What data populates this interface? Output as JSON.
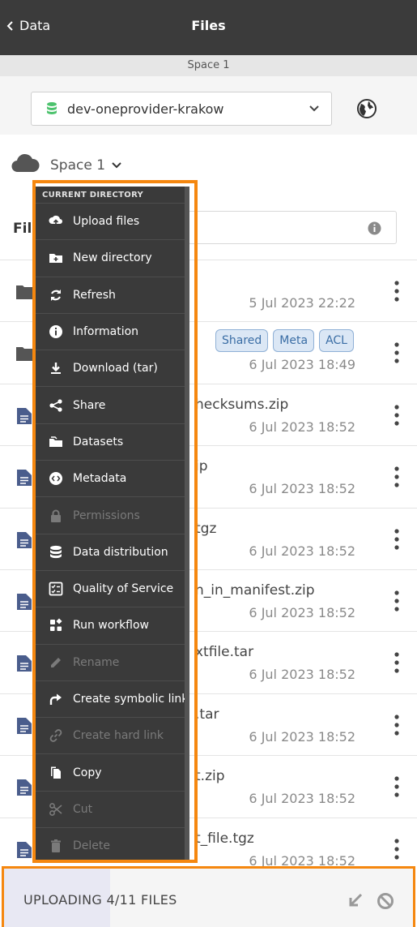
{
  "header": {
    "back_label": "Data",
    "title": "Files"
  },
  "space_bar": {
    "label": "Space 1"
  },
  "provider": {
    "selected": "dev-oneprovider-krakow"
  },
  "breadcrumb": {
    "label": "Space 1"
  },
  "files_heading": "File",
  "context_menu": {
    "header": "CURRENT DIRECTORY",
    "items": [
      {
        "label": "Upload files",
        "icon": "upload-icon",
        "disabled": false
      },
      {
        "label": "New directory",
        "icon": "new-folder-icon",
        "disabled": false
      },
      {
        "label": "Refresh",
        "icon": "refresh-icon",
        "disabled": false
      },
      {
        "label": "Information",
        "icon": "info-icon",
        "disabled": false
      },
      {
        "label": "Download (tar)",
        "icon": "download-icon",
        "disabled": false
      },
      {
        "label": "Share",
        "icon": "share-icon",
        "disabled": false
      },
      {
        "label": "Datasets",
        "icon": "datasets-icon",
        "disabled": false
      },
      {
        "label": "Metadata",
        "icon": "metadata-icon",
        "disabled": false
      },
      {
        "label": "Permissions",
        "icon": "lock-icon",
        "disabled": true
      },
      {
        "label": "Data distribution",
        "icon": "database-icon",
        "disabled": false
      },
      {
        "label": "Quality of Service",
        "icon": "qos-icon",
        "disabled": false
      },
      {
        "label": "Run workflow",
        "icon": "workflow-icon",
        "disabled": false
      },
      {
        "label": "Rename",
        "icon": "pencil-icon",
        "disabled": true
      },
      {
        "label": "Create symbolic link",
        "icon": "symlink-icon",
        "disabled": false
      },
      {
        "label": "Create hard link",
        "icon": "link-icon",
        "disabled": true
      },
      {
        "label": "Copy",
        "icon": "copy-icon",
        "disabled": false
      },
      {
        "label": "Cut",
        "icon": "scissors-icon",
        "disabled": true
      },
      {
        "label": "Delete",
        "icon": "trash-icon",
        "disabled": true
      }
    ]
  },
  "files": [
    {
      "type": "folder",
      "name_visible": "",
      "date": "5 Jul 2023 22:22",
      "tags": []
    },
    {
      "type": "folder",
      "name_visible": "",
      "date": "6 Jul 2023 18:49",
      "tags": [
        "Shared",
        "Meta",
        "ACL"
      ]
    },
    {
      "type": "file",
      "name_visible": "hecksums.zip",
      "date": "6 Jul 2023 18:52",
      "tags": []
    },
    {
      "type": "file",
      "name_visible": "ip",
      "date": "6 Jul 2023 18:52",
      "tags": []
    },
    {
      "type": "file",
      "name_visible": "tgz",
      "date": "6 Jul 2023 18:52",
      "tags": []
    },
    {
      "type": "file",
      "name_visible": "n_in_manifest.zip",
      "date": "6 Jul 2023 18:52",
      "tags": []
    },
    {
      "type": "file",
      "name_visible": "xtfile.tar",
      "date": "6 Jul 2023 18:52",
      "tags": []
    },
    {
      "type": "file",
      "name_visible": ".tar",
      "date": "6 Jul 2023 18:52",
      "tags": []
    },
    {
      "type": "file",
      "name_visible": "t.zip",
      "date": "6 Jul 2023 18:52",
      "tags": []
    },
    {
      "type": "file",
      "name_visible": "t_file.tgz",
      "date": "6 Jul 2023 18:52",
      "tags": []
    }
  ],
  "upload": {
    "label": "UPLOADING 4/11 FILES",
    "progress": 0.26
  },
  "colors": {
    "accent": "#f5870f",
    "topbar": "#3b3b3b",
    "file_icon": "#4a5d8c",
    "provider_icon": "#4cc26d",
    "tag_bg": "#dbe7f5"
  }
}
